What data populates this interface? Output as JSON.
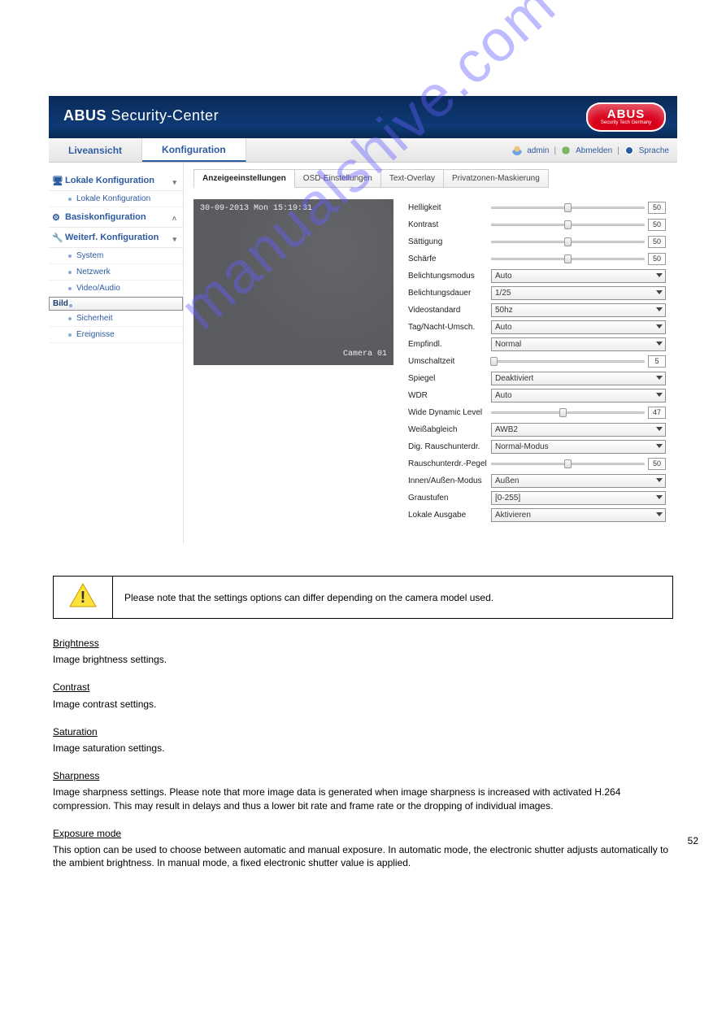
{
  "header": {
    "brand_bold": "ABUS",
    "brand_rest": " Security-Center",
    "logo_line1": "ABUS",
    "logo_line2": "Security Tech Germany"
  },
  "topTabs": {
    "live": "Liveansicht",
    "config": "Konfiguration"
  },
  "account": {
    "user": "admin",
    "logout": "Abmelden",
    "lang": "Sprache"
  },
  "sidebar": {
    "cat0": {
      "label": "Lokale Konfiguration",
      "items": [
        "Lokale Konfiguration"
      ]
    },
    "cat1": {
      "label": "Basiskonfiguration"
    },
    "cat2": {
      "label": "Weiterf. Konfiguration",
      "items": [
        "System",
        "Netzwerk",
        "Video/Audio",
        "Bild",
        "Sicherheit",
        "Ereignisse"
      ]
    }
  },
  "subtabs": [
    "Anzeigeeinstellungen",
    "OSD-Einstellungen",
    "Text-Overlay",
    "Privatzonen-Maskierung"
  ],
  "preview": {
    "timestamp": "30-09-2013 Mon 15:19:31",
    "camera": "Camera 01"
  },
  "settings": [
    {
      "k": "slider",
      "label": "Helligkeit",
      "value": "50",
      "pct": 50
    },
    {
      "k": "slider",
      "label": "Kontrast",
      "value": "50",
      "pct": 50
    },
    {
      "k": "slider",
      "label": "Sättigung",
      "value": "50",
      "pct": 50
    },
    {
      "k": "slider",
      "label": "Schärfe",
      "value": "50",
      "pct": 50
    },
    {
      "k": "select",
      "label": "Belichtungsmodus",
      "value": "Auto"
    },
    {
      "k": "select",
      "label": "Belichtungsdauer",
      "value": "1/25"
    },
    {
      "k": "select",
      "label": "Videostandard",
      "value": "50hz"
    },
    {
      "k": "select",
      "label": "Tag/Nacht-Umsch.",
      "value": "Auto"
    },
    {
      "k": "select",
      "label": "Empfindl.",
      "value": "Normal"
    },
    {
      "k": "slider",
      "label": "Umschaltzeit",
      "value": "5",
      "pct": 2
    },
    {
      "k": "select",
      "label": "Spiegel",
      "value": "Deaktiviert"
    },
    {
      "k": "select",
      "label": "WDR",
      "value": "Auto"
    },
    {
      "k": "slider",
      "label": "Wide Dynamic Level",
      "value": "47",
      "pct": 47
    },
    {
      "k": "select",
      "label": "Weißabgleich",
      "value": "AWB2"
    },
    {
      "k": "select",
      "label": "Dig. Rauschunterdr.",
      "value": "Normal-Modus"
    },
    {
      "k": "slider",
      "label": "Rauschunterdr.-Pegel",
      "value": "50",
      "pct": 50
    },
    {
      "k": "select",
      "label": "Innen/Außen-Modus",
      "value": "Außen"
    },
    {
      "k": "select",
      "label": "Graustufen",
      "value": "[0-255]"
    },
    {
      "k": "select",
      "label": "Lokale Ausgabe",
      "value": "Aktivieren"
    }
  ],
  "watermark": "manualshive.com",
  "note": "Please note that the settings options can differ depending on the camera model used.",
  "defs": [
    {
      "t": "Brightness",
      "d": "Image brightness settings."
    },
    {
      "t": "Contrast",
      "d": "Image contrast settings."
    },
    {
      "t": "Saturation",
      "d": "Image saturation settings."
    },
    {
      "t": "Sharpness",
      "d": "Image sharpness settings. Please note that more image data is generated when image sharpness is increased with activated H.264 compression. This may result in delays and thus a lower bit rate and frame rate or the dropping of individual images."
    },
    {
      "t": "Exposure mode",
      "d": "This option can be used to choose between automatic and manual exposure. In automatic mode, the electronic shutter adjusts automatically to the ambient brightness. In manual mode, a fixed electronic shutter value is applied."
    }
  ],
  "pageNumber": "52"
}
